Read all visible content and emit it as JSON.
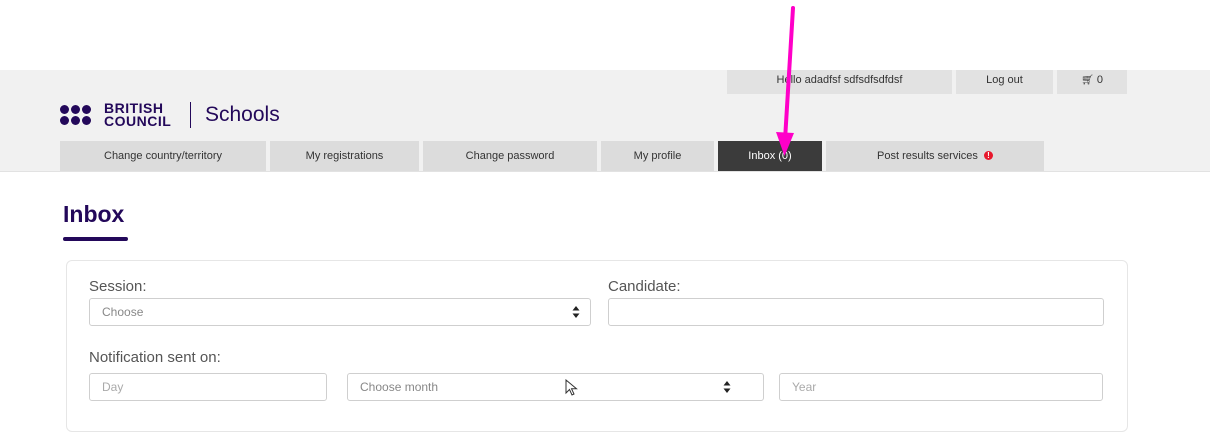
{
  "header": {
    "logo_text_line1": "BRITISH",
    "logo_text_line2": "COUNCIL",
    "logo_suffix": "Schools",
    "greeting": "Hello adadfsf sdfsdfsdfdsf",
    "logout_label": "Log out",
    "cart_count": "0"
  },
  "nav": {
    "tabs": [
      {
        "label": "Change country/territory"
      },
      {
        "label": "My registrations"
      },
      {
        "label": "Change password"
      },
      {
        "label": "My profile"
      },
      {
        "label": "Inbox (0)",
        "active": true
      },
      {
        "label": "Post results services",
        "alert": "!"
      }
    ]
  },
  "page": {
    "title": "Inbox"
  },
  "filters": {
    "session_label": "Session:",
    "session_value": "Choose",
    "candidate_label": "Candidate:",
    "candidate_value": "",
    "notification_label": "Notification sent on:",
    "day_placeholder": "Day",
    "month_value": "Choose month",
    "year_placeholder": "Year"
  },
  "colors": {
    "brand": "#23085a",
    "active_tab": "#3b3b3b",
    "alert": "#e8182c",
    "annotation_arrow": "#ff00c8"
  },
  "icons": {
    "cart": "shopping-cart-icon",
    "select_arrows": "sort-arrows-icon",
    "alert": "exclamation-icon"
  }
}
